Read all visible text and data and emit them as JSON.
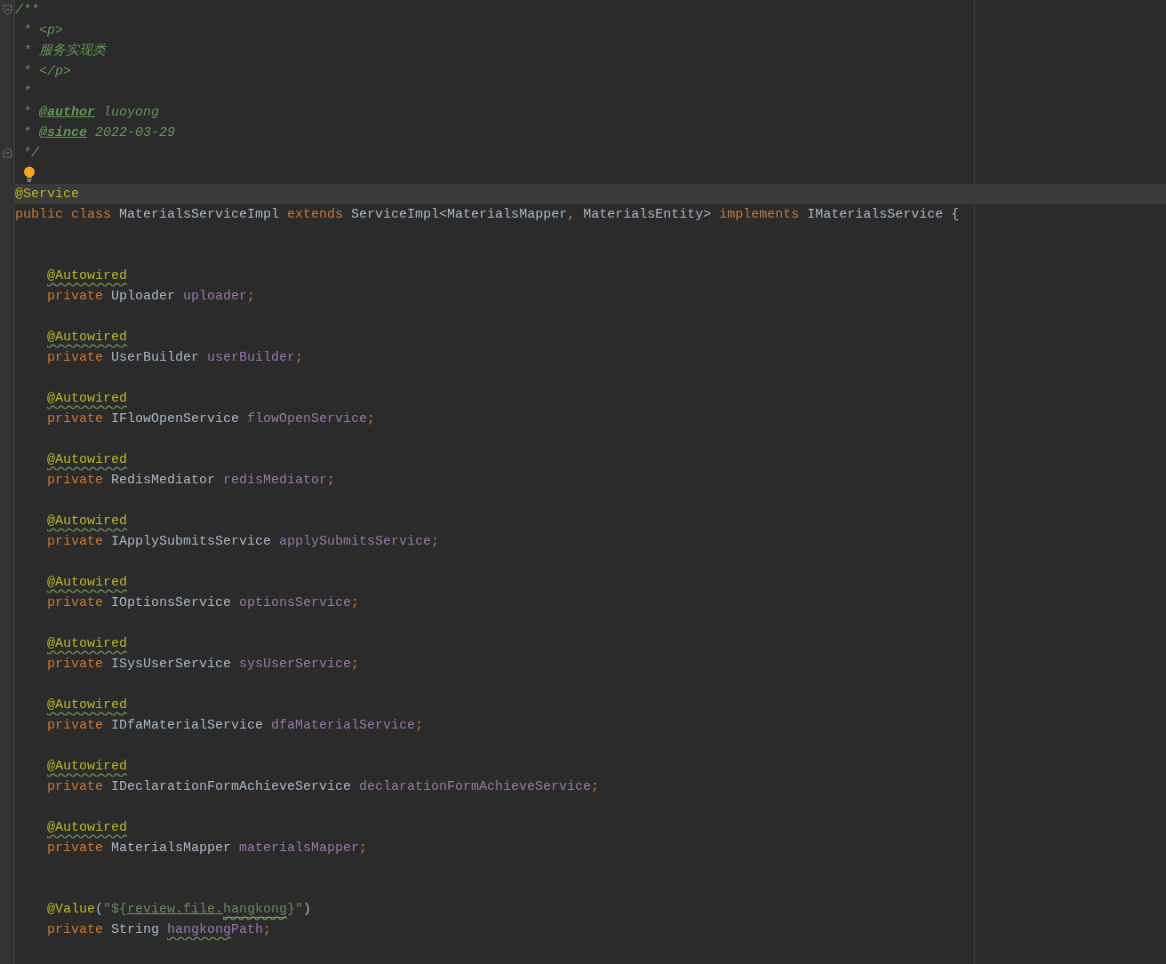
{
  "editor": {
    "lines": [
      {
        "kind": "fold_start",
        "current": false,
        "tokens": [
          {
            "text": "/**",
            "kind": "doc"
          }
        ]
      },
      {
        "kind": "code",
        "current": false,
        "tokens": [
          {
            "text": " * <p>",
            "kind": "doc"
          }
        ]
      },
      {
        "kind": "code",
        "current": false,
        "tokens": [
          {
            "text": " * 服务实现类",
            "kind": "doc"
          }
        ]
      },
      {
        "kind": "code",
        "current": false,
        "tokens": [
          {
            "text": " * </p>",
            "kind": "doc"
          }
        ]
      },
      {
        "kind": "code",
        "current": false,
        "tokens": [
          {
            "text": " *",
            "kind": "doc"
          }
        ]
      },
      {
        "kind": "code",
        "current": false,
        "tokens": [
          {
            "text": " * ",
            "kind": "doc"
          },
          {
            "text": "@author",
            "kind": "doctag"
          },
          {
            "text": " luoyong",
            "kind": "doc"
          }
        ]
      },
      {
        "kind": "code",
        "current": false,
        "tokens": [
          {
            "text": " * ",
            "kind": "doc"
          },
          {
            "text": "@since",
            "kind": "doctag"
          },
          {
            "text": " 2022-03-29",
            "kind": "doc"
          }
        ]
      },
      {
        "kind": "fold_end",
        "current": false,
        "tokens": [
          {
            "text": " */",
            "kind": "doc"
          }
        ]
      },
      {
        "kind": "bulb",
        "current": false
      },
      {
        "kind": "code",
        "current": true,
        "tokens": [
          {
            "text": "@Service",
            "kind": "annotation"
          }
        ]
      },
      {
        "kind": "code",
        "current": false,
        "tokens": [
          {
            "text": "public class",
            "kind": "keyword"
          },
          {
            "text": " MaterialsServiceImpl ",
            "kind": "plain"
          },
          {
            "text": "extends",
            "kind": "keyword"
          },
          {
            "text": " ServiceImpl<MaterialsMapper",
            "kind": "plain"
          },
          {
            "text": ",",
            "kind": "keyword"
          },
          {
            "text": " MaterialsEntity> ",
            "kind": "plain"
          },
          {
            "text": "implements",
            "kind": "keyword"
          },
          {
            "text": " IMaterialsService {",
            "kind": "plain"
          }
        ]
      },
      {
        "kind": "blank",
        "current": false
      },
      {
        "kind": "blank",
        "current": false
      },
      {
        "kind": "member",
        "current": false,
        "tokens": [
          {
            "text": "@Autowired",
            "kind": "annotation",
            "warning": true
          }
        ]
      },
      {
        "kind": "member",
        "current": false,
        "tokens": [
          {
            "text": "private",
            "kind": "keyword"
          },
          {
            "text": " Uploader ",
            "kind": "plain"
          },
          {
            "text": "uploader",
            "kind": "field"
          },
          {
            "text": ";",
            "kind": "keyword"
          }
        ]
      },
      {
        "kind": "blank",
        "current": false
      },
      {
        "kind": "member",
        "current": false,
        "tokens": [
          {
            "text": "@Autowired",
            "kind": "annotation",
            "warning": true
          }
        ]
      },
      {
        "kind": "member",
        "current": false,
        "tokens": [
          {
            "text": "private",
            "kind": "keyword"
          },
          {
            "text": " UserBuilder ",
            "kind": "plain"
          },
          {
            "text": "userBuilder",
            "kind": "field"
          },
          {
            "text": ";",
            "kind": "keyword"
          }
        ]
      },
      {
        "kind": "blank",
        "current": false
      },
      {
        "kind": "member",
        "current": false,
        "tokens": [
          {
            "text": "@Autowired",
            "kind": "annotation",
            "warning": true
          }
        ]
      },
      {
        "kind": "member",
        "current": false,
        "tokens": [
          {
            "text": "private",
            "kind": "keyword"
          },
          {
            "text": " IFlowOpenService ",
            "kind": "plain"
          },
          {
            "text": "flowOpenService",
            "kind": "field"
          },
          {
            "text": ";",
            "kind": "keyword"
          }
        ]
      },
      {
        "kind": "blank",
        "current": false
      },
      {
        "kind": "member",
        "current": false,
        "tokens": [
          {
            "text": "@Autowired",
            "kind": "annotation",
            "warning": true
          }
        ]
      },
      {
        "kind": "member",
        "current": false,
        "tokens": [
          {
            "text": "private",
            "kind": "keyword"
          },
          {
            "text": " RedisMediator ",
            "kind": "plain"
          },
          {
            "text": "redisMediator",
            "kind": "field"
          },
          {
            "text": ";",
            "kind": "keyword"
          }
        ]
      },
      {
        "kind": "blank",
        "current": false
      },
      {
        "kind": "member",
        "current": false,
        "tokens": [
          {
            "text": "@Autowired",
            "kind": "annotation",
            "warning": true
          }
        ]
      },
      {
        "kind": "member",
        "current": false,
        "tokens": [
          {
            "text": "private",
            "kind": "keyword"
          },
          {
            "text": " IApplySubmitsService ",
            "kind": "plain"
          },
          {
            "text": "applySubmitsService",
            "kind": "field"
          },
          {
            "text": ";",
            "kind": "keyword"
          }
        ]
      },
      {
        "kind": "blank",
        "current": false
      },
      {
        "kind": "member",
        "current": false,
        "tokens": [
          {
            "text": "@Autowired",
            "kind": "annotation",
            "warning": true
          }
        ]
      },
      {
        "kind": "member",
        "current": false,
        "tokens": [
          {
            "text": "private",
            "kind": "keyword"
          },
          {
            "text": " IOptionsService ",
            "kind": "plain"
          },
          {
            "text": "optionsService",
            "kind": "field"
          },
          {
            "text": ";",
            "kind": "keyword"
          }
        ]
      },
      {
        "kind": "blank",
        "current": false
      },
      {
        "kind": "member",
        "current": false,
        "tokens": [
          {
            "text": "@Autowired",
            "kind": "annotation",
            "warning": true
          }
        ]
      },
      {
        "kind": "member",
        "current": false,
        "tokens": [
          {
            "text": "private",
            "kind": "keyword"
          },
          {
            "text": " ISysUserService ",
            "kind": "plain"
          },
          {
            "text": "sysUserService",
            "kind": "field"
          },
          {
            "text": ";",
            "kind": "keyword"
          }
        ]
      },
      {
        "kind": "blank",
        "current": false
      },
      {
        "kind": "member",
        "current": false,
        "tokens": [
          {
            "text": "@Autowired",
            "kind": "annotation",
            "warning": true
          }
        ]
      },
      {
        "kind": "member",
        "current": false,
        "tokens": [
          {
            "text": "private",
            "kind": "keyword"
          },
          {
            "text": " IDfaMaterialService ",
            "kind": "plain"
          },
          {
            "text": "dfaMaterialService",
            "kind": "field"
          },
          {
            "text": ";",
            "kind": "keyword"
          }
        ]
      },
      {
        "kind": "blank",
        "current": false
      },
      {
        "kind": "member",
        "current": false,
        "tokens": [
          {
            "text": "@Autowired",
            "kind": "annotation",
            "warning": true
          }
        ]
      },
      {
        "kind": "member",
        "current": false,
        "tokens": [
          {
            "text": "private",
            "kind": "keyword"
          },
          {
            "text": " IDeclarationFormAchieveService ",
            "kind": "plain"
          },
          {
            "text": "declarationFormAchieveService",
            "kind": "field"
          },
          {
            "text": ";",
            "kind": "keyword"
          }
        ]
      },
      {
        "kind": "blank",
        "current": false
      },
      {
        "kind": "member",
        "current": false,
        "tokens": [
          {
            "text": "@Autowired",
            "kind": "annotation",
            "warning": true
          }
        ]
      },
      {
        "kind": "member",
        "current": false,
        "tokens": [
          {
            "text": "private",
            "kind": "keyword"
          },
          {
            "text": " MaterialsMapper ",
            "kind": "plain"
          },
          {
            "text": "materialsMapper",
            "kind": "field"
          },
          {
            "text": ";",
            "kind": "keyword"
          }
        ]
      },
      {
        "kind": "blank",
        "current": false
      },
      {
        "kind": "blank",
        "current": false
      },
      {
        "kind": "member",
        "current": false,
        "tokens": [
          {
            "text": "@Value",
            "kind": "annotation"
          },
          {
            "text": "(",
            "kind": "plain"
          },
          {
            "text": "\"${",
            "kind": "string"
          },
          {
            "text": "review.file.",
            "kind": "string",
            "reference": true
          },
          {
            "text": "hangkong",
            "kind": "string",
            "reference": true,
            "warning": true
          },
          {
            "text": "}\"",
            "kind": "string"
          },
          {
            "text": ")",
            "kind": "plain"
          }
        ]
      },
      {
        "kind": "member",
        "current": false,
        "tokens": [
          {
            "text": "private",
            "kind": "keyword"
          },
          {
            "text": " String ",
            "kind": "plain"
          },
          {
            "text": "hangkong",
            "kind": "field",
            "warning": true
          },
          {
            "text": "Path",
            "kind": "field"
          },
          {
            "text": ";",
            "kind": "keyword"
          }
        ]
      }
    ]
  }
}
